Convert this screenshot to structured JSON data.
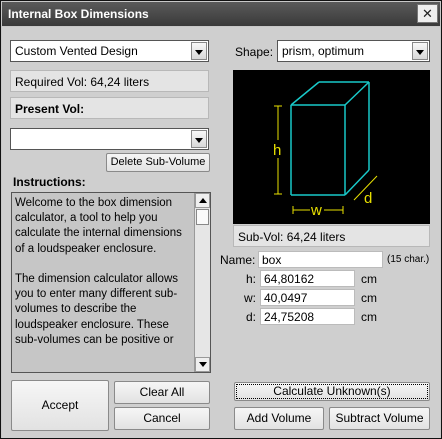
{
  "window": {
    "title": "Internal Box Dimensions",
    "close_glyph": "✕"
  },
  "design_select": {
    "value": "Custom Vented Design"
  },
  "required_vol": "Required Vol: 64,24 liters",
  "present_vol_label": "Present Vol:",
  "subvolume_select": {
    "value": ""
  },
  "delete_subvolume_label": "Delete Sub-Volume",
  "instructions": {
    "label": "Instructions:",
    "text": "Welcome to the box dimension calculator, a tool to help you calculate the internal dimensions of a loudspeaker enclosure.\n\nThe dimension calculator allows you to enter many different sub-volumes to describe the loudspeaker enclosure. These sub-volumes can be positive or"
  },
  "shape": {
    "label": "Shape:",
    "value": "prism, optimum"
  },
  "preview": {
    "h_label": "h",
    "w_label": "w",
    "d_label": "d",
    "box_color": "#19c9c9",
    "dim_color": "#e8e000"
  },
  "subvol": "Sub-Vol: 64,24 liters",
  "name": {
    "label": "Name:",
    "value": "box",
    "hint": "(15 char.)"
  },
  "dims": [
    {
      "label": "h:",
      "value": "64,80162",
      "unit": "cm"
    },
    {
      "label": "w:",
      "value": "40,0497",
      "unit": "cm"
    },
    {
      "label": "d:",
      "value": "24,75208",
      "unit": "cm"
    }
  ],
  "buttons": {
    "accept": "Accept",
    "clear_all": "Clear All",
    "cancel": "Cancel",
    "calculate": "Calculate Unknown(s)",
    "add_volume": "Add Volume",
    "subtract_volume": "Subtract Volume"
  }
}
